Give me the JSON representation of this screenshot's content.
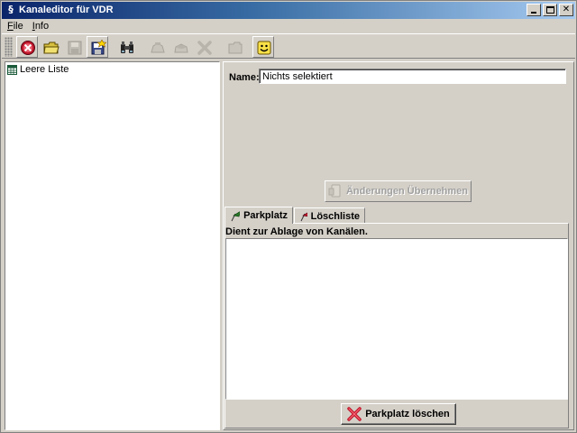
{
  "window": {
    "title": "Kanaleditor für VDR"
  },
  "menu": {
    "items": [
      {
        "label": "File",
        "mnemonic": "F",
        "rest": "ile"
      },
      {
        "label": "Info",
        "mnemonic": "I",
        "rest": "nfo"
      }
    ]
  },
  "toolbar": {
    "buttons": [
      {
        "icon": "close-list-icon",
        "enabled": true
      },
      {
        "icon": "open-folder-icon",
        "enabled": true
      },
      {
        "icon": "save-icon",
        "enabled": false
      },
      {
        "icon": "save-as-icon",
        "enabled": true
      },
      {
        "icon": "binoculars-icon",
        "enabled": true
      },
      {
        "icon": "cut-icon",
        "enabled": false
      },
      {
        "icon": "paste-icon",
        "enabled": false
      },
      {
        "icon": "delete-icon",
        "enabled": false
      },
      {
        "icon": "folder-icon",
        "enabled": false
      },
      {
        "icon": "smiley-icon",
        "enabled": true
      }
    ]
  },
  "tree": {
    "root_label": "Leere Liste"
  },
  "detail": {
    "name_label": "Name:",
    "name_value": "Nichts selektiert",
    "apply_label": "Änderungen Übernehmen"
  },
  "tabs": [
    {
      "label": "Parkplatz",
      "active": true
    },
    {
      "label": "Löschliste",
      "active": false
    }
  ],
  "parkplatz": {
    "description": "Dient zur Ablage von Kanälen.",
    "clear_label": "Parkplatz löschen"
  },
  "colors": {
    "title_start": "#0a246a",
    "title_end": "#a6caf0",
    "face": "#d4d0c8",
    "delete_red": "#c0182c",
    "flag_green": "#2a7a2a"
  }
}
